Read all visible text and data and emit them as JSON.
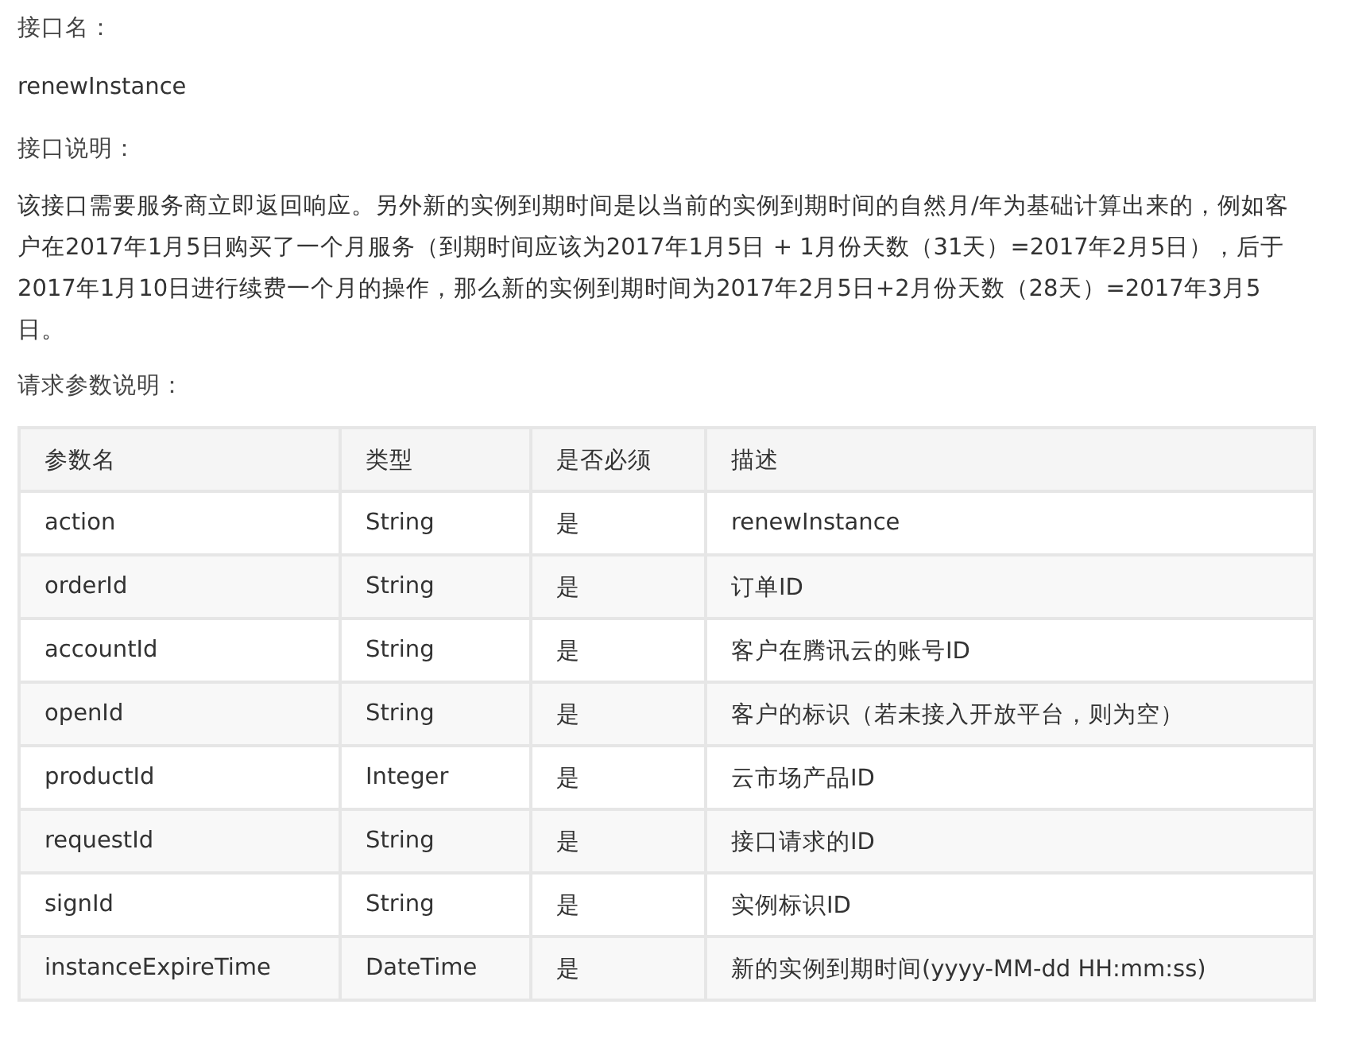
{
  "interface_name_label": "接口名：",
  "interface_name": "renewInstance",
  "description_label": "接口说明：",
  "description": "该接口需要服务商立即返回响应。另外新的实例到期时间是以当前的实例到期时间的自然月/年为基础计算出来的，例如客户在2017年1月5日购买了一个月服务（到期时间应该为2017年1月5日 + 1月份天数（31天）=2017年2月5日），后于2017年1月10日进行续费一个月的操作，那么新的实例到期时间为2017年2月5日+2月份天数（28天）=2017年3月5日。",
  "params_label": "请求参数说明：",
  "table": {
    "columns": [
      "参数名",
      "类型",
      "是否必须",
      "描述"
    ],
    "rows": [
      [
        "action",
        "String",
        "是",
        "renewInstance"
      ],
      [
        "orderId",
        "String",
        "是",
        "订单ID"
      ],
      [
        "accountId",
        "String",
        "是",
        "客户在腾讯云的账号ID"
      ],
      [
        "openId",
        "String",
        "是",
        "客户的标识（若未接入开放平台，则为空）"
      ],
      [
        "productId",
        "Integer",
        "是",
        "云市场产品ID"
      ],
      [
        "requestId",
        "String",
        "是",
        "接口请求的ID"
      ],
      [
        "signId",
        "String",
        "是",
        "实例标识ID"
      ],
      [
        "instanceExpireTime",
        "DateTime",
        "是",
        "新的实例到期时间(yyyy-MM-dd HH:mm:ss)"
      ]
    ]
  }
}
